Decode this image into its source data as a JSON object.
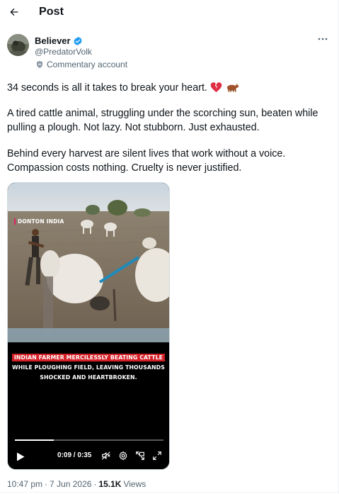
{
  "header": {
    "title": "Post"
  },
  "author": {
    "name": "Believer",
    "handle": "@PredatorVolk",
    "label": "Commentary account"
  },
  "post": {
    "line1": "34 seconds is all it takes to break your heart.",
    "line1_emoji": [
      "broken-heart-icon",
      "ox-icon"
    ],
    "para2": "A tired cattle animal, struggling under the scorching sun, beaten while pulling a plough. Not lazy. Not stubborn. Just exhausted.",
    "para3": "Behind every harvest are silent lives that work without a voice. Compassion costs nothing. Cruelty is never justified."
  },
  "video": {
    "watermark": "DONTON INDIA",
    "caption_highlight": "INDIAN FARMER MERCILESSLY BEATING CATTLE",
    "caption_line2": "WHILE PLOUGHING FIELD, LEAVING THOUSANDS",
    "caption_line3": "SHOCKED AND HEARTBROKEN.",
    "time_display": "0:09 / 0:35",
    "progress_fraction": 0.26,
    "controls": [
      "play-icon",
      "mute-icon",
      "settings-icon",
      "minimize-icon",
      "fullscreen-icon"
    ]
  },
  "meta": {
    "time": "10:47 pm",
    "date": "7 Jun 2026",
    "separator": "·",
    "views_count": "15.1K",
    "views_label": "Views"
  },
  "colors": {
    "text": "#0f1419",
    "muted": "#536471",
    "verified": "#1d9bf0",
    "caption_red": "#d32026"
  }
}
